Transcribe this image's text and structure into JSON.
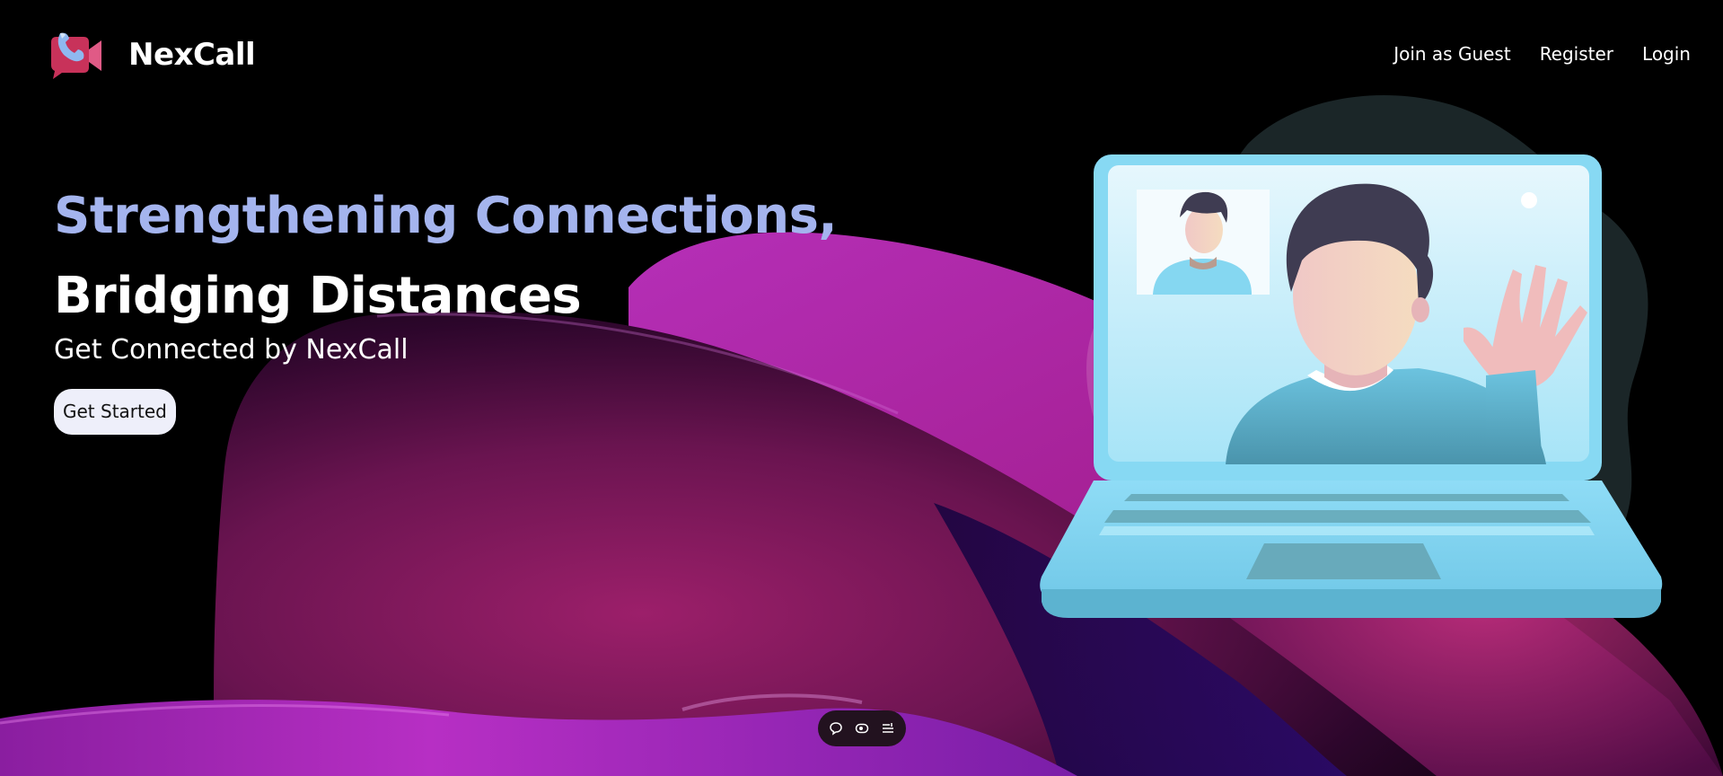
{
  "brand": {
    "name": "NexCall",
    "logo_icon": "video-call-icon",
    "colors": {
      "logo_red": "#c8325a",
      "logo_pink": "#e05a86"
    }
  },
  "nav": {
    "links": [
      "Join as Guest",
      "Register",
      "Login"
    ]
  },
  "hero": {
    "headline_line1": "Strengthening Connections,",
    "headline_line2": "Bridging Distances",
    "subtitle": "Get Connected by NexCall",
    "cta_label": "Get Started",
    "colors": {
      "headline_accent": "#a4b4ee",
      "cta_background": "#eeeffa"
    }
  },
  "illustration": {
    "subject": "laptop-video-call-icon",
    "colors": {
      "laptop": "#87d9f3",
      "blob": "#1b2628",
      "person_hair": "#3f3c52",
      "person_shirt": "#5fb0ca"
    }
  },
  "floating_toolbar": {
    "buttons": [
      "chat-bubble-icon",
      "eye-icon",
      "list-settings-icon"
    ]
  },
  "background": {
    "colors": {
      "base": "#000000",
      "wave_magenta": "#b01fb0",
      "wave_deep": "#4a0a3e"
    }
  }
}
